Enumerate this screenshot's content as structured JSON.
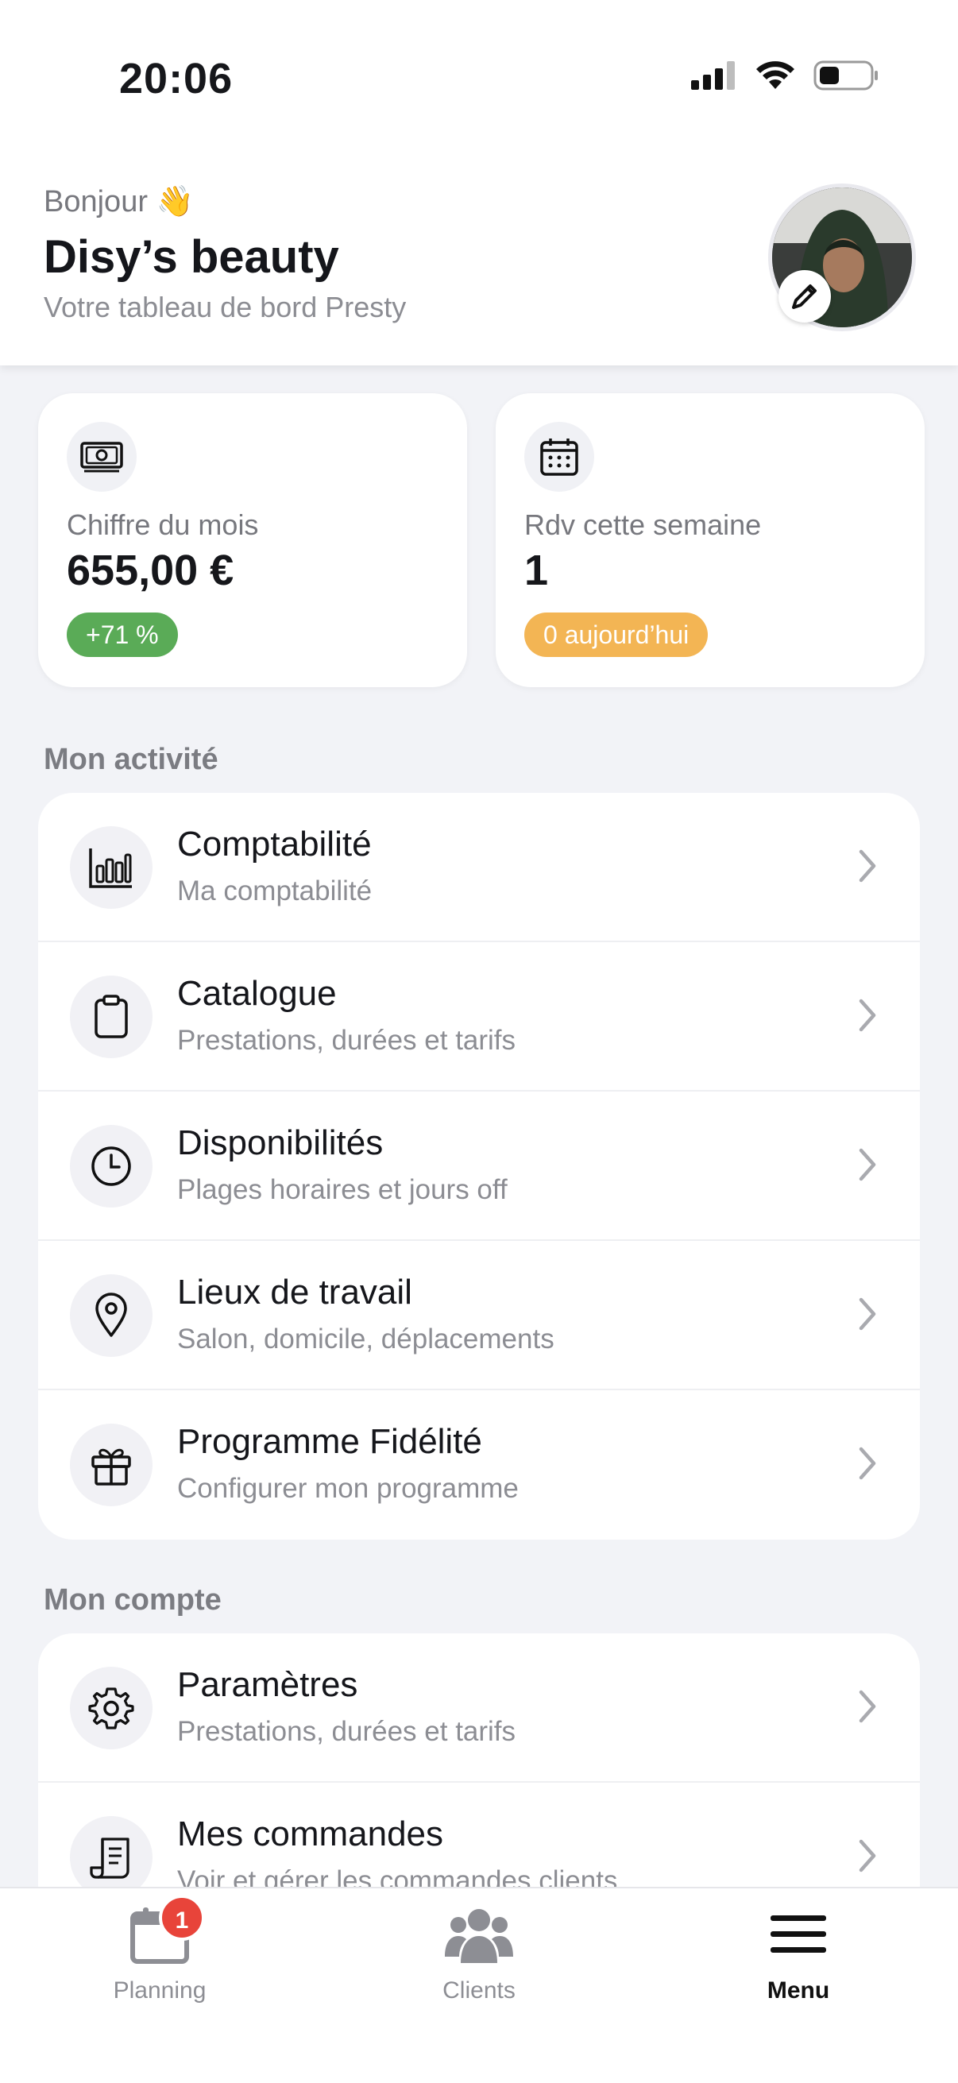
{
  "status": {
    "time": "20:06"
  },
  "header": {
    "greeting": "Bonjour 👋",
    "shop_name": "Disy’s beauty",
    "subtitle": "Votre tableau de bord Presty"
  },
  "stats": [
    {
      "icon": "banknote-icon",
      "label": "Chiffre du mois",
      "value": "655,00 €",
      "badge": "+71 %",
      "badge_color": "#5aab57"
    },
    {
      "icon": "calendar-icon",
      "label": "Rdv cette semaine",
      "value": "1",
      "badge": "0 aujourd’hui",
      "badge_color": "#f3b554"
    }
  ],
  "activity": {
    "title": "Mon activité",
    "items": [
      {
        "icon": "bar-chart-icon",
        "title": "Comptabilité",
        "desc": "Ma comptabilité"
      },
      {
        "icon": "clipboard-icon",
        "title": "Catalogue",
        "desc": "Prestations, durées et tarifs"
      },
      {
        "icon": "clock-icon",
        "title": "Disponibilités",
        "desc": "Plages horaires et jours off"
      },
      {
        "icon": "location-pin-icon",
        "title": "Lieux de travail",
        "desc": "Salon, domicile, déplacements"
      },
      {
        "icon": "gift-icon",
        "title": "Programme Fidélité",
        "desc": "Configurer mon programme"
      }
    ]
  },
  "account": {
    "title": "Mon compte",
    "items": [
      {
        "icon": "gear-icon",
        "title": "Paramètres",
        "desc": "Prestations, durées et tarifs"
      },
      {
        "icon": "receipt-icon",
        "title": "Mes commandes",
        "desc": "Voir et gérer les commandes clients"
      }
    ]
  },
  "tabbar": {
    "tabs": [
      {
        "icon": "calendar-tab-icon",
        "label": "Planning",
        "badge": "1"
      },
      {
        "icon": "people-icon",
        "label": "Clients"
      },
      {
        "icon": "hamburger-icon",
        "label": "Menu",
        "active": true
      }
    ]
  }
}
